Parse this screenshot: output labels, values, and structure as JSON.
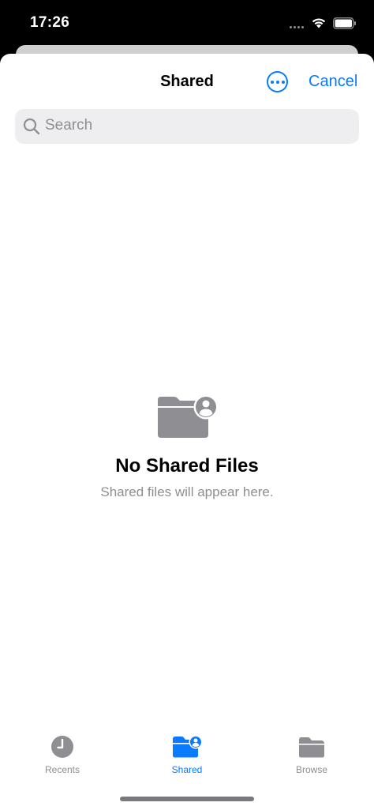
{
  "status_bar": {
    "time": "17:26"
  },
  "nav": {
    "title": "Shared",
    "cancel_label": "Cancel"
  },
  "search": {
    "placeholder": "Search",
    "value": ""
  },
  "empty_state": {
    "title": "No Shared Files",
    "subtitle": "Shared files will appear here."
  },
  "tabs": [
    {
      "label": "Recents",
      "icon": "clock-icon",
      "active": false
    },
    {
      "label": "Shared",
      "icon": "shared-folder-icon",
      "active": true
    },
    {
      "label": "Browse",
      "icon": "folder-icon",
      "active": false
    }
  ],
  "colors": {
    "accent": "#0a7aff",
    "inactive": "#8e8e93",
    "icon_gray": "#8e8e93"
  }
}
